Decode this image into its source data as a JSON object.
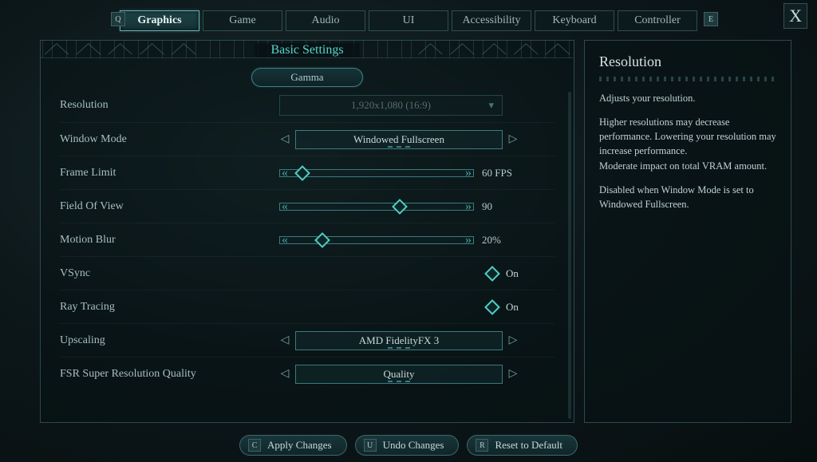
{
  "keyhints": {
    "prev": "Q",
    "next": "E",
    "close": "X"
  },
  "tabs": [
    {
      "label": "Graphics",
      "active": true
    },
    {
      "label": "Game",
      "active": false
    },
    {
      "label": "Audio",
      "active": false
    },
    {
      "label": "UI",
      "active": false
    },
    {
      "label": "Accessibility",
      "active": false
    },
    {
      "label": "Keyboard",
      "active": false
    },
    {
      "label": "Controller",
      "active": false
    }
  ],
  "section_title": "Basic Settings",
  "gamma_button": "Gamma",
  "settings": {
    "resolution": {
      "label": "Resolution",
      "value": "1,920x1,080 (16:9)",
      "type": "dropdown",
      "disabled": true
    },
    "window_mode": {
      "label": "Window Mode",
      "value": "Windowed Fullscreen",
      "type": "selector"
    },
    "frame_limit": {
      "label": "Frame Limit",
      "value": "60 FPS",
      "type": "slider",
      "pct": 12
    },
    "fov": {
      "label": "Field Of View",
      "value": "90",
      "type": "slider",
      "pct": 62
    },
    "motion_blur": {
      "label": "Motion Blur",
      "value": "20%",
      "type": "slider",
      "pct": 22
    },
    "vsync": {
      "label": "VSync",
      "value": "On",
      "type": "toggle"
    },
    "ray_tracing": {
      "label": "Ray Tracing",
      "value": "On",
      "type": "toggle"
    },
    "upscaling": {
      "label": "Upscaling",
      "value": "AMD FidelityFX 3",
      "type": "selector"
    },
    "fsr_quality": {
      "label": "FSR Super Resolution Quality",
      "value": "Quality",
      "type": "selector"
    }
  },
  "sidebar": {
    "title": "Resolution",
    "p1": "Adjusts your resolution.",
    "p2": "Higher resolutions may decrease performance. Lowering your resolution may increase performance.",
    "p3": "Moderate impact on total VRAM amount.",
    "p4": "Disabled when Window Mode is set to Windowed Fullscreen."
  },
  "footer": {
    "apply": {
      "key": "C",
      "label": "Apply Changes"
    },
    "undo": {
      "key": "U",
      "label": "Undo Changes"
    },
    "reset": {
      "key": "R",
      "label": "Reset to Default"
    }
  }
}
